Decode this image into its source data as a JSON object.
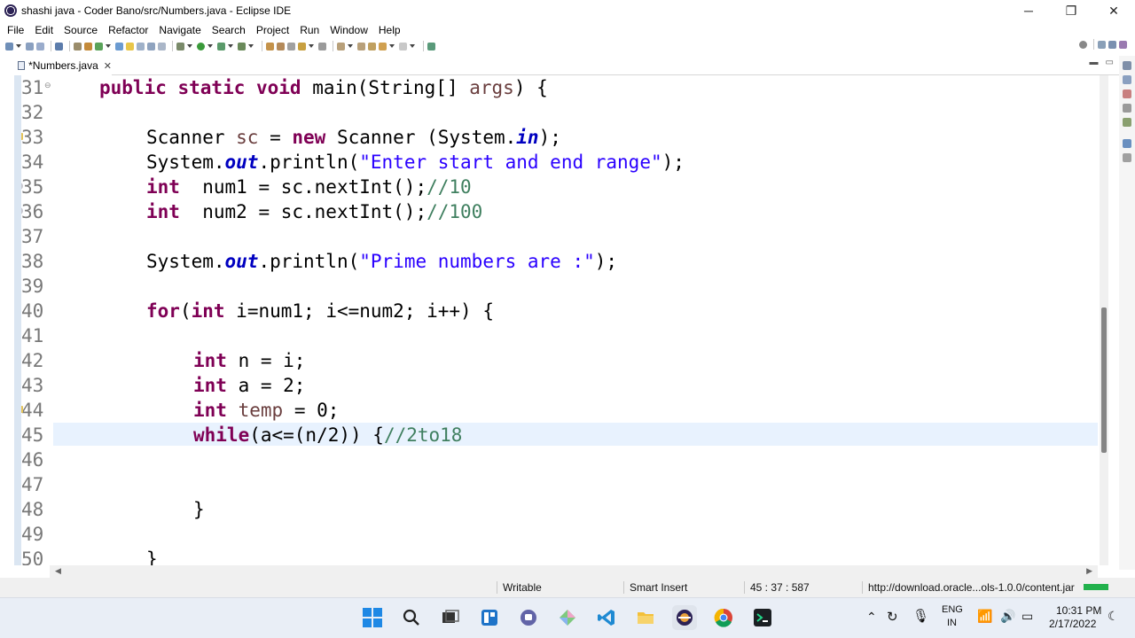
{
  "window": {
    "title": "shashi java - Coder Bano/src/Numbers.java - Eclipse IDE",
    "minimize": "─",
    "maximize": "❐",
    "close": "✕"
  },
  "menu": [
    "File",
    "Edit",
    "Source",
    "Refactor",
    "Navigate",
    "Search",
    "Project",
    "Run",
    "Window",
    "Help"
  ],
  "editor_tab": {
    "label": "*Numbers.java",
    "close": "✕"
  },
  "editor": {
    "line_numbers": [
      "31",
      "32",
      "33",
      "34",
      "35",
      "36",
      "37",
      "38",
      "39",
      "40",
      "41",
      "42",
      "43",
      "44",
      "45",
      "46",
      "47",
      "48",
      "49",
      "50"
    ],
    "code": {
      "l31_kw": "public static void",
      "l31_rest": " main(String[] ",
      "l31_var": "args",
      "l31_end": ") {",
      "l33_a": "Scanner ",
      "l33_var": "sc",
      "l33_b": " = ",
      "l33_kw": "new",
      "l33_c": " Scanner (System.",
      "l33_fld": "in",
      "l33_d": ");",
      "l34_a": "System.",
      "l34_fld": "out",
      "l34_b": ".println(",
      "l34_str": "\"Enter start and end range\"",
      "l34_c": ");",
      "l35_kw": "int",
      "l35_a": "  num1 = sc.nextInt();",
      "l35_cm": "//10",
      "l36_kw": "int",
      "l36_a": "  num2 = sc.nextInt();",
      "l36_cm": "//100",
      "l38_a": "System.",
      "l38_fld": "out",
      "l38_b": ".println(",
      "l38_str": "\"Prime numbers are :\"",
      "l38_c": ");",
      "l40_kw1": "for",
      "l40_a": "(",
      "l40_kw2": "int",
      "l40_b": " i=num1; i<=num2; i++) {",
      "l42_kw": "int",
      "l42_a": " n = i;",
      "l43_kw": "int",
      "l43_a": " a = 2;",
      "l44_kw": "int",
      "l44_sp": " ",
      "l44_var": "temp",
      "l44_a": " = 0;",
      "l45_kw": "while",
      "l45_a": "(a<=(n/2)) {",
      "l45_cm": "//2to18",
      "l48": "}",
      "l50": "}"
    }
  },
  "status": {
    "writable": "Writable",
    "insert_mode": "Smart Insert",
    "position": "45 : 37 : 587",
    "task": "http://download.oracle...ols-1.0.0/content.jar"
  },
  "taskbar": {
    "lang_line1": "ENG",
    "lang_line2": "IN",
    "time": "10:31 PM",
    "date": "2/17/2022"
  },
  "colors": {
    "keyword": "#7f0055",
    "string": "#2a00ff",
    "comment": "#3f7f5f",
    "field": "#0000c0",
    "current_line": "#e8f2fe"
  }
}
